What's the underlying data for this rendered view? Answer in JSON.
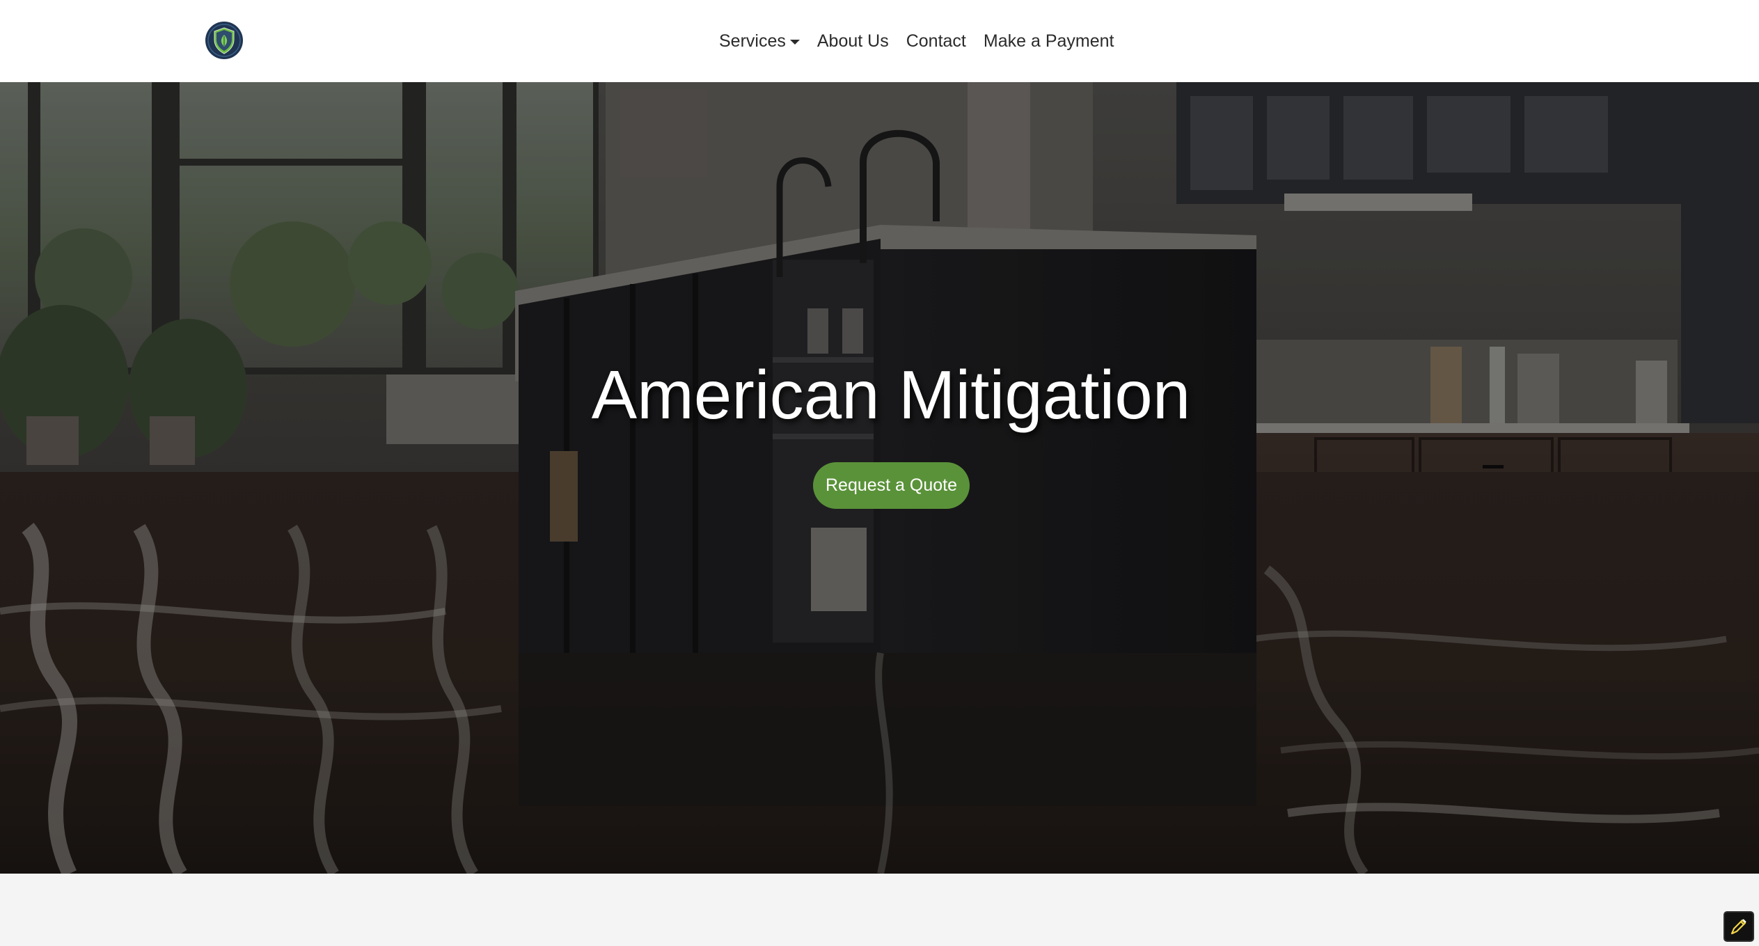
{
  "header": {
    "logo_icon": "shield-leaf-icon",
    "nav": {
      "services_label": "Services",
      "about_label": "About Us",
      "contact_label": "Contact",
      "payment_label": "Make a Payment"
    }
  },
  "hero": {
    "title": "American Mitigation",
    "cta_label": "Request a Quote",
    "background_image": "flooded-kitchen-photo"
  },
  "floating_tool": {
    "icon": "pencil-icon"
  },
  "colors": {
    "accent_green": "#5a9239",
    "logo_navy": "#1f3552",
    "nav_text": "#2b2b2b",
    "page_background": "#f4f4f4"
  }
}
